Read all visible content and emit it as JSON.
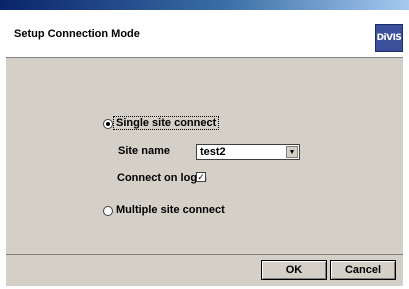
{
  "window": {
    "title": "Setup Connection Mode"
  },
  "logo": {
    "text": "DiVIS"
  },
  "options": {
    "single": {
      "label": "Single site connect",
      "selected": true
    },
    "multiple": {
      "label": "Multiple site connect",
      "selected": false
    }
  },
  "site_name": {
    "label": "Site name",
    "value": "test2"
  },
  "connect_on_login": {
    "label": "Connect on login",
    "checked": true,
    "mark": "✓"
  },
  "buttons": {
    "ok": "OK",
    "cancel": "Cancel"
  }
}
